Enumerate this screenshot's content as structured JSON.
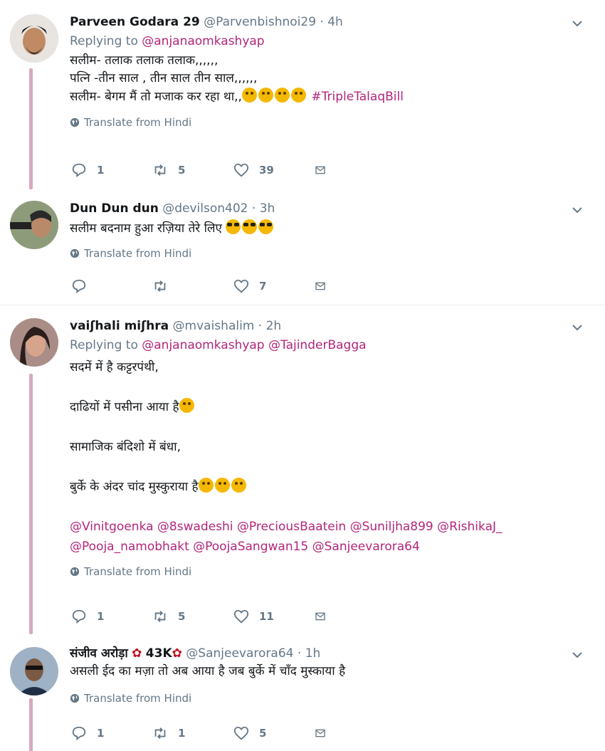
{
  "translate_label": "Translate from Hindi",
  "tweets": [
    {
      "name": "Parveen Godara 29",
      "handle": "@Parvenbishnoi29",
      "time": "4h",
      "replying_prefix": "Replying to",
      "replying_to": "@anjanaomkashyap",
      "lines": [
        "सलीम-  तलाक तलाक तलाक,,,,,,",
        "पत्नि -तीन साल , तीन साल तीन साल,,,,,,",
        "सलीम- बेगम मैं तो मजाक कर रहा था,,"
      ],
      "hashtag": "#TripleTalaqBill",
      "replies": "1",
      "retweets": "5",
      "likes": "39"
    },
    {
      "name": "Dun Dun dun",
      "handle": "@devilson402",
      "time": "3h",
      "lines": [
        "सलीम बदनाम हुआ रज़िया तेरे लिए"
      ],
      "replies": "",
      "retweets": "",
      "likes": "7"
    },
    {
      "name": "vaiʃhali miʃhra",
      "handle": "@mvaishalim",
      "time": "2h",
      "replying_prefix": "Replying to",
      "replying_to": "@anjanaomkashyap @TajinderBagga",
      "lines": [
        "सदमें में है कट्टरपंथी,",
        "",
        "दाढियों में पसीना आया है",
        "",
        "सामाजिक बंदिशो में बंधा,",
        "",
        "बुर्के के अंदर चांद मुस्कुराया है",
        ""
      ],
      "mentions_line1": "@Vinitgoenka @8swadeshi @PreciousBaatein @Suniljha899 @RishikaJ_",
      "mentions_line2": "@Pooja_namobhakt @PoojaSangwan15 @Sanjeevarora64",
      "replies": "1",
      "retweets": "5",
      "likes": "11"
    },
    {
      "name": "संजीव अरोड़ा",
      "name_suffix": "43K",
      "handle": "@Sanjeevarora64",
      "time": "1h",
      "lines": [
        "असली ईद का मज़ा तो अब आया है जब बुर्के में चाँद मुस्काया है"
      ],
      "replies": "1",
      "retweets": "1",
      "likes": "5"
    }
  ],
  "colors": {
    "accent": "#b2267a",
    "muted": "#657786",
    "thread": "#d9a8c0"
  }
}
